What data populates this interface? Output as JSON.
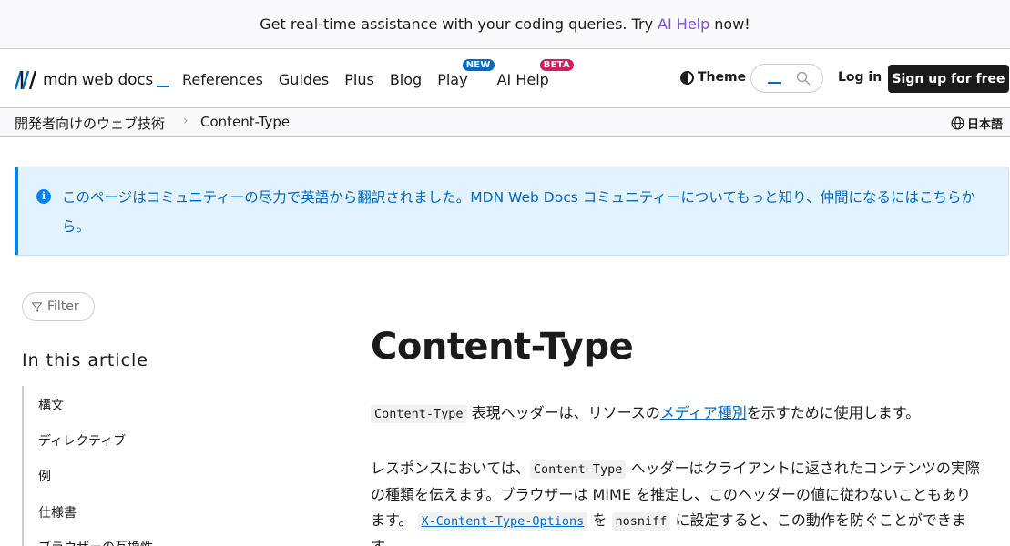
{
  "banner": {
    "prefix": "Get real-time assistance with your coding queries. Try",
    "link": "AI Help",
    "suffix": "now!"
  },
  "nav": {
    "logo_text": "mdn web docs",
    "items": [
      {
        "label": "References"
      },
      {
        "label": "Guides"
      },
      {
        "label": "Plus"
      },
      {
        "label": "Blog"
      },
      {
        "label": "Play",
        "badge": "NEW"
      },
      {
        "label": "AI Help",
        "badge": "BETA"
      }
    ],
    "theme_label": "Theme",
    "login_label": "Log in",
    "signup_label": "Sign up for free"
  },
  "breadcrumb": {
    "items": [
      "開発者向けのウェブ技術",
      "Content-Type"
    ],
    "separator": "›",
    "language": "日本語"
  },
  "notice": {
    "text": "このページはコミュニティーの尽力で英語から翻訳されました。MDN Web Docs コミュニティーについてもっと知り、仲間になるにはこちらから。"
  },
  "sidebar": {
    "filter_label": "Filter",
    "toc_title": "In this article",
    "toc_items": [
      "構文",
      "ディレクティブ",
      "例",
      "仕様書",
      "ブラウザーの互換性"
    ]
  },
  "article": {
    "title": "Content-Type",
    "p1": {
      "code": "Content-Type",
      "text_a": " 表現ヘッダーは、リソースの",
      "link": "メディア種別",
      "text_b": "を示すために使用します。"
    },
    "p2": {
      "text_a": "レスポンスにおいては、",
      "code1": "Content-Type",
      "text_b": " ヘッダーはクライアントに返されたコンテンツの実際の種類を伝えます。ブラウザーは MIME を推定し、このヘッダーの値に従わないこともあります。",
      "code_link": "X-Content-Type-Options",
      "text_c": " を ",
      "code2": "nosniff",
      "text_d": " に設定すると、この動作を防ぐことができます。"
    }
  },
  "colors": {
    "accent": "#0069c2",
    "ai_help_link": "#7f4de0",
    "badge_new": "#0069c2",
    "badge_beta": "#d01f5d",
    "notice_bg": "#e3f2ff"
  }
}
